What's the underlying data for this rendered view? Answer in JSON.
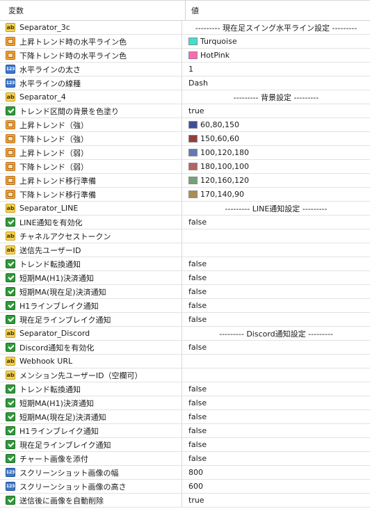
{
  "header": {
    "name_col": "変数",
    "value_col": "値"
  },
  "rows": [
    {
      "icon": "ab",
      "name": "Separator_3c",
      "value": "--------- 現在足スイング水平ライン設定 ---------",
      "sep": true
    },
    {
      "icon": "color",
      "name": "上昇トレンド時の水平ライン色",
      "value": "Turquoise",
      "color": "#40E0D0"
    },
    {
      "icon": "color",
      "name": "下降トレンド時の水平ライン色",
      "value": "HotPink",
      "color": "#FF69B4"
    },
    {
      "icon": "num",
      "name": "水平ラインの太さ",
      "value": "1"
    },
    {
      "icon": "num",
      "name": "水平ラインの線種",
      "value": "Dash"
    },
    {
      "icon": "ab",
      "name": "Separator_4",
      "value": "--------- 背景設定 ---------",
      "sep": true
    },
    {
      "icon": "bool",
      "name": "トレンド区間の背景を色塗り",
      "value": "true"
    },
    {
      "icon": "color",
      "name": "上昇トレンド（強）",
      "value": "60,80,150",
      "color": "#3C5096"
    },
    {
      "icon": "color",
      "name": "下降トレンド（強）",
      "value": "150,60,60",
      "color": "#963C3C"
    },
    {
      "icon": "color",
      "name": "上昇トレンド（弱）",
      "value": "100,120,180",
      "color": "#6478B4"
    },
    {
      "icon": "color",
      "name": "下降トレンド（弱）",
      "value": "180,100,100",
      "color": "#B46464"
    },
    {
      "icon": "color",
      "name": "上昇トレンド移行準備",
      "value": "120,160,120",
      "color": "#78A078"
    },
    {
      "icon": "color",
      "name": "下降トレンド移行準備",
      "value": "170,140,90",
      "color": "#AA8C5A"
    },
    {
      "icon": "ab",
      "name": "Separator_LINE",
      "value": "--------- LINE通知設定 ---------",
      "sep": true
    },
    {
      "icon": "bool",
      "name": "LINE通知を有効化",
      "value": "false"
    },
    {
      "icon": "ab",
      "name": "チャネルアクセストークン",
      "value": ""
    },
    {
      "icon": "ab",
      "name": "送信先ユーザーID",
      "value": ""
    },
    {
      "icon": "bool",
      "name": "トレンド転換通知",
      "value": "false"
    },
    {
      "icon": "bool",
      "name": "短期MA(H1)決済通知",
      "value": "false"
    },
    {
      "icon": "bool",
      "name": "短期MA(現在足)決済通知",
      "value": "false"
    },
    {
      "icon": "bool",
      "name": "H1ラインブレイク通知",
      "value": "false"
    },
    {
      "icon": "bool",
      "name": "現在足ラインブレイク通知",
      "value": "false"
    },
    {
      "icon": "ab",
      "name": "Separator_Discord",
      "value": "--------- Discord通知設定 ---------",
      "sep": true
    },
    {
      "icon": "bool",
      "name": "Discord通知を有効化",
      "value": "false"
    },
    {
      "icon": "ab",
      "name": "Webhook URL",
      "value": ""
    },
    {
      "icon": "ab",
      "name": "メンション先ユーザーID（空欄可）",
      "value": ""
    },
    {
      "icon": "bool",
      "name": "トレンド転換通知",
      "value": "false"
    },
    {
      "icon": "bool",
      "name": "短期MA(H1)決済通知",
      "value": "false"
    },
    {
      "icon": "bool",
      "name": "短期MA(現在足)決済通知",
      "value": "false"
    },
    {
      "icon": "bool",
      "name": "H1ラインブレイク通知",
      "value": "false"
    },
    {
      "icon": "bool",
      "name": "現在足ラインブレイク通知",
      "value": "false"
    },
    {
      "icon": "bool",
      "name": "チャート画像を添付",
      "value": "false"
    },
    {
      "icon": "num",
      "name": "スクリーンショット画像の幅",
      "value": "800"
    },
    {
      "icon": "num",
      "name": "スクリーンショット画像の高さ",
      "value": "600"
    },
    {
      "icon": "bool",
      "name": "送信後に画像を自動削除",
      "value": "true"
    }
  ]
}
